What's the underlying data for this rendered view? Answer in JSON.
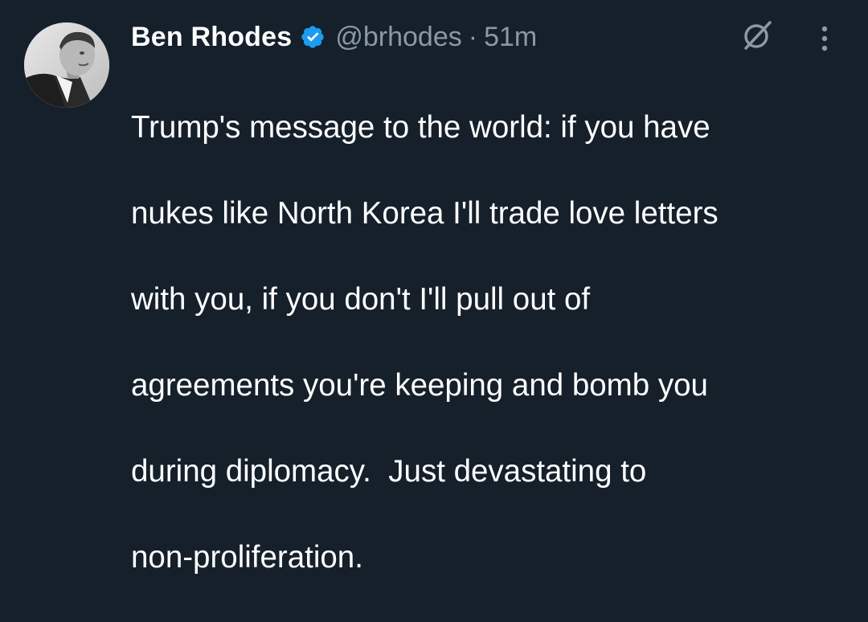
{
  "tweet": {
    "author_name": "Ben Rhodes",
    "handle": "@brhodes",
    "separator": "·",
    "time": "51m",
    "text_lines": [
      "Trump's message to the world: if you have",
      "nukes like North Korea I'll trade love letters",
      "with you, if you don't I'll pull out of",
      "agreements you're keeping and bomb you",
      "during diplomacy.  Just devastating to",
      "non-proliferation."
    ]
  },
  "icons": {
    "verified": "verified-badge-icon",
    "grok": "grok-icon",
    "more": "more-options-icon"
  },
  "colors": {
    "background": "#15202b",
    "text": "#ffffff",
    "secondary_text": "#8b98a5",
    "verified_blue": "#1d9bf0"
  }
}
